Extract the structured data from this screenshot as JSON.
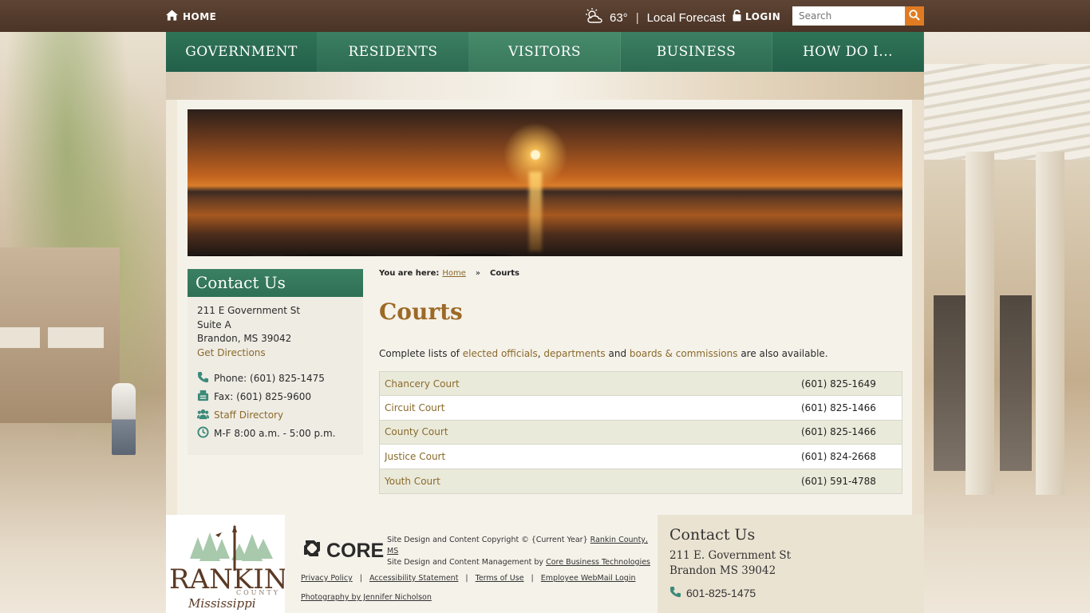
{
  "topbar": {
    "home_label": "HOME",
    "temperature": "63°",
    "forecast_label": "Local Forecast",
    "login_label": "LOGIN",
    "search_placeholder": "Search"
  },
  "nav": {
    "items": [
      {
        "label": "GOVERNMENT"
      },
      {
        "label": "RESIDENTS"
      },
      {
        "label": "VISITORS"
      },
      {
        "label": "BUSINESS"
      },
      {
        "label": "HOW DO I..."
      }
    ]
  },
  "sidebar": {
    "title": "Contact Us",
    "address_line1": "211 E Government St",
    "address_line2": "Suite A",
    "address_line3": "Brandon, MS 39042",
    "directions_label": "Get Directions",
    "phone": "Phone: (601) 825-1475",
    "fax": "Fax: (601) 825-9600",
    "staff_directory": "Staff Directory",
    "hours": "M-F 8:00 a.m. - 5:00 p.m."
  },
  "breadcrumb": {
    "prefix": "You are here:",
    "home": "Home",
    "separator": "»",
    "current": "Courts"
  },
  "page": {
    "title": "Courts",
    "intro_before": "Complete lists of",
    "link_officials": "elected officials",
    "comma": ",",
    "link_departments": "departments",
    "and": "and",
    "link_boards": "boards & commissions",
    "intro_after": "are also available."
  },
  "courts": [
    {
      "name": "Chancery Court",
      "phone": "(601) 825-1649"
    },
    {
      "name": "Circuit Court",
      "phone": "(601) 825-1466"
    },
    {
      "name": "County Court",
      "phone": "(601) 825-1466"
    },
    {
      "name": "Justice Court",
      "phone": "(601) 824-2668"
    },
    {
      "name": "Youth Court",
      "phone": "(601) 591-4788"
    }
  ],
  "footer": {
    "logo_text": "RANKIN",
    "logo_sub": "COUNTY",
    "logo_script": "Mississippi",
    "core_label": "CORE",
    "copyright_line1": "Site Design and Content Copyright © {Current Year}",
    "copyright_link1": "Rankin County, MS",
    "copyright_line2": "Site Design and Content Management by",
    "copyright_link2": "Core Business Technologies",
    "links": [
      "Privacy Policy",
      "Accessibility Statement",
      "Terms of Use",
      "Employee WebMail Login"
    ],
    "photo_credit": "Photography by Jennifer Nicholson",
    "contact_title": "Contact Us",
    "contact_address1": "211 E. Government St",
    "contact_address2": "Brandon MS 39042",
    "contact_phone": "601-825-1475"
  },
  "colors": {
    "topbar": "#4f3829",
    "nav_green": "#2f7457",
    "accent_orange": "#e07b22",
    "title_brown": "#9c6a26",
    "link_brown": "#8a6a2a"
  }
}
